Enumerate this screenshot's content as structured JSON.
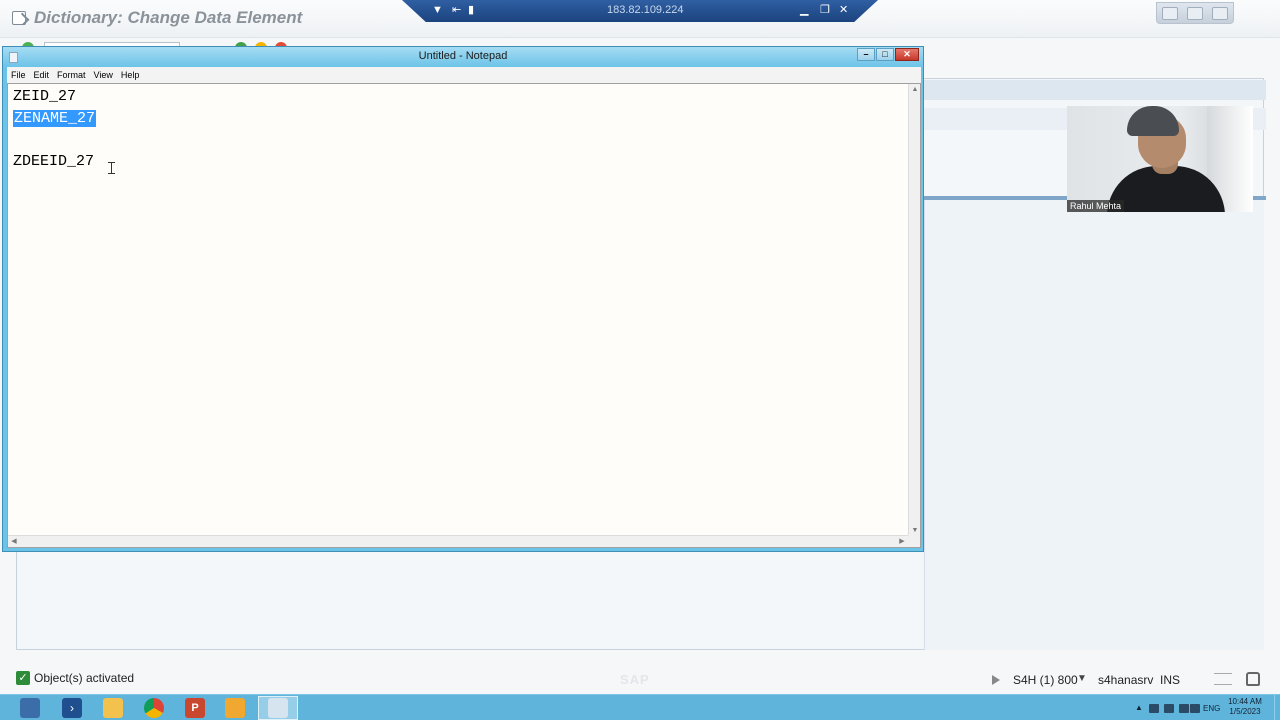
{
  "sap": {
    "window_title": "Dictionary: Change Data Element",
    "status_message": "Object(s) activated",
    "system": "S4H (1) 800",
    "server": "s4hanasrv",
    "mode": "INS",
    "logo": "SAP"
  },
  "rdp": {
    "host": "183.82.109.224"
  },
  "notepad": {
    "title": "Untitled - Notepad",
    "menu": [
      "File",
      "Edit",
      "Format",
      "View",
      "Help"
    ],
    "lines": [
      "ZEID_27",
      "ZENAME_27",
      "",
      "ZDEEID_27"
    ],
    "selected_line_index": 1
  },
  "webcam": {
    "participant_name": "Rahul Mehta"
  },
  "taskbar": {
    "apps": [
      "server-manager-icon",
      "powershell-icon",
      "file-explorer-icon",
      "chrome-icon",
      "powerpoint-icon",
      "sap-logon-icon",
      "notepad-icon"
    ],
    "language": "ENG",
    "time": "10:44 AM",
    "date": "1/5/2023"
  },
  "colors": {
    "selection": "#3399ff",
    "notepad_frame": "#6cc3e8",
    "taskbar": "#5fb4dc",
    "status_ok": "#2e8b3a"
  }
}
